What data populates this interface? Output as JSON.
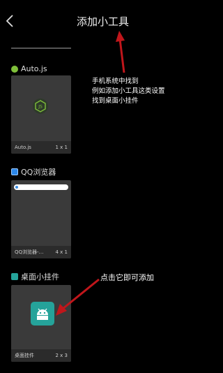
{
  "header": {
    "title": "添加小工具",
    "back_icon": "chevron-left-icon"
  },
  "widgets": [
    {
      "app_name": "Auto.js",
      "widget_name": "Auto.js",
      "size": "1 x 1",
      "icon": "nodejs-icon"
    },
    {
      "app_name": "QQ浏览器",
      "widget_name": "QQ浏览器-…",
      "size": "4 x 1",
      "icon": "qq-browser-icon"
    },
    {
      "app_name": "桌面小挂件",
      "widget_name": "桌面挂件",
      "size": "2 x 3",
      "icon": "android-icon"
    }
  ],
  "annotations": {
    "note1_line1": "手机系统中找到",
    "note1_line2": "例如添加小工具这类设置",
    "note1_line3": "找到桌面小挂件",
    "note2": "点击它即可添加"
  },
  "colors": {
    "background": "#000000",
    "card": "#3a3a3a",
    "arrow": "#c0161b",
    "widget_tile": "#25a39a"
  }
}
